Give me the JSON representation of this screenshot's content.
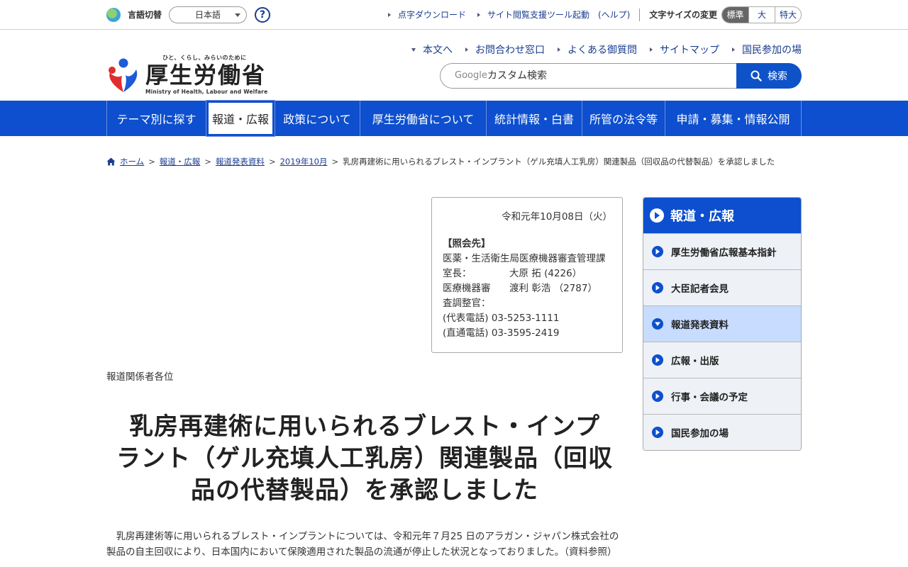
{
  "util": {
    "lang_label": "言語切替",
    "lang_value": "日本語",
    "help_glyph": "?",
    "links": [
      "点字ダウンロード",
      "サイト閲覧支援ツール起動　(ヘルプ)"
    ],
    "font_size_label": "文字サイズの変更",
    "font_sizes": [
      "標準",
      "大",
      "特大"
    ],
    "font_size_selected": "標準"
  },
  "header": {
    "logo_tagline": "ひと、くらし、みらいのために",
    "logo_name": "厚生労働省",
    "logo_en": "Ministry of Health, Labour and Welfare",
    "links": [
      "本文へ",
      "お問合わせ窓口",
      "よくある御質問",
      "サイトマップ",
      "国民参加の場"
    ],
    "search_prefix": "Google",
    "search_placeholder": "カスタム検索",
    "search_button": "検索"
  },
  "gnav": {
    "items": [
      "テーマ別に探す",
      "報道・広報",
      "政策について",
      "厚生労働省について",
      "統計情報・白書",
      "所管の法令等",
      "申請・募集・情報公開"
    ],
    "active": "報道・広報"
  },
  "breadcrumb": {
    "items": [
      "ホーム",
      "報道・広報",
      "報道発表資料",
      "2019年10月"
    ],
    "current": "乳房再建術に用いられるブレスト・インプラント（ゲル充填人工乳房）関連製品（回収品の代替製品）を承認しました"
  },
  "contact": {
    "date": "令和元年10月08日（火）",
    "heading": "【照会先】",
    "department": "医薬・生活衛生局医療機器審査管理課",
    "rows": [
      {
        "role": "室長：",
        "name": "大原 拓 (4226）"
      },
      {
        "role": "医療機器審",
        "name": "渡利 彰浩 （2787）"
      },
      {
        "role": "査調整官：",
        "name": ""
      }
    ],
    "phone_main": "(代表電話) 03-5253-1111",
    "phone_direct": "(直通電話) 03-3595-2419"
  },
  "article": {
    "recipients": "報道関係者各位",
    "title_lines": [
      "乳房再建術に用いられるブレスト・インプ",
      "ラント（ゲル充填人工乳房）関連製品（回収",
      "品の代替製品）を承認しました"
    ],
    "body": "乳房再建術等に用いられるブレスト・インプラントについては、令和元年７月25 日のアラガン・ジャパン株式会社の製品の自主回収により、日本国内において保険適用された製品の流通が停止した状況となっておりました。（資料参照）"
  },
  "side": {
    "heading": "報道・広報",
    "items": [
      "厚生労働省広報基本指針",
      "大臣記者会見",
      "報道発表資料",
      "広報・出版",
      "行事・会議の予定",
      "国民参加の場"
    ],
    "current": "報道発表資料"
  },
  "colors": {
    "primary_blue": "#0d4fce",
    "link_blue": "#1a3d8f",
    "side_current": "#c7dcff"
  }
}
